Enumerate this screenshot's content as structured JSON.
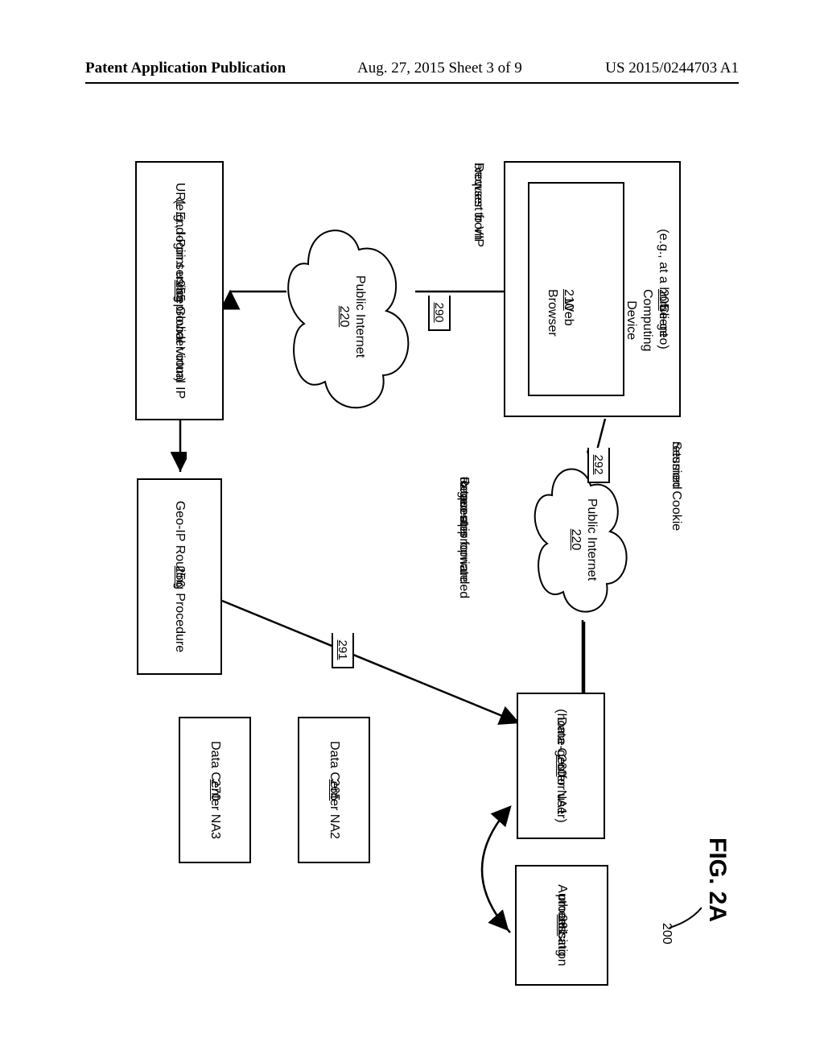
{
  "header": {
    "left": "Patent Application Publication",
    "mid": "Aug. 27, 2015  Sheet 3 of 9",
    "right": "US 2015/0244703 A1"
  },
  "fig": {
    "title": "FIG. 2A",
    "ref_overall": "200",
    "client_box_line1": "Client Computing Device",
    "client_box_ref": "205",
    "client_box_sub": "(e.g., at a home-geo)",
    "browser_label": "Web Browser",
    "browser_ref": "210",
    "req_to_vip_1": "Request from",
    "req_to_vip_2": "browser to VIP",
    "session_cookie_1": "Session Cookie",
    "session_cookie_2": "returned",
    "cloud_label": "Public Internet",
    "cloud_ref": "220",
    "url_box_l1": "URL End-Point using Global Virtual IP",
    "url_box_l2": "(e.g., login.serviceprovider.com)",
    "url_box_ref": "255",
    "geoip_l1": "Geo-IP Routing Procedure",
    "geoip_ref": "256",
    "fwd_l1": "Request is forwarded",
    "fwd_l2": "to geo-appropriate",
    "fwd_l3": "datacenter",
    "dc1_l1": "Data Center NA1",
    "dc1_l2": "(home-geo for user)",
    "dc1_ref": "260",
    "dc2_l1": "Data Center NA2",
    "dc2_ref": "265",
    "dc3_l1": "Data Center NA3",
    "dc3_ref": "270",
    "auth_l1": "Authentication",
    "auth_l2": "processing",
    "auth_ref": "261",
    "step290": "290",
    "step291": "291",
    "step292": "292"
  }
}
